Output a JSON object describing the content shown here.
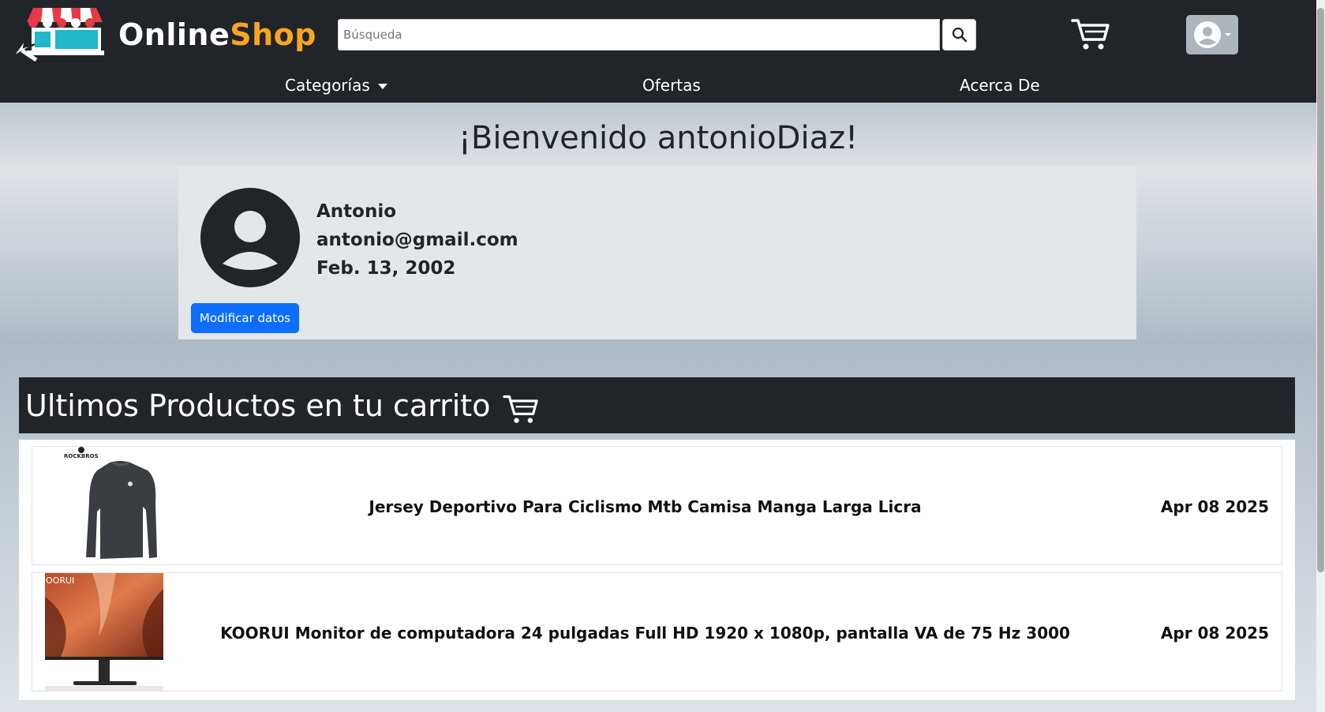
{
  "brand": {
    "name_part1": "Online",
    "name_part2": "Shop"
  },
  "search": {
    "placeholder": "Búsqueda"
  },
  "nav": {
    "categories": "Categorías",
    "offers": "Ofertas",
    "about": "Acerca De"
  },
  "welcome": "¡Bienvenido antonioDiaz!",
  "profile": {
    "name": "Antonio",
    "email": "antonio@gmail.com",
    "birthdate": "Feb. 13, 2002",
    "modify_label": "Modificar datos"
  },
  "cart": {
    "title": "Ultimos Productos en tu carrito",
    "items": [
      {
        "name": "Jersey Deportivo Para Ciclismo Mtb Camisa Manga Larga Licra",
        "date": "Apr 08 2025",
        "brand_text": "ROCKBROS"
      },
      {
        "name": "KOORUI Monitor de computadora 24 pulgadas Full HD 1920 x 1080p, pantalla VA de 75 Hz 3000",
        "date": "Apr 08 2025",
        "brand_text": "OORUI"
      }
    ]
  },
  "colors": {
    "navbar": "#212529",
    "primary_button": "#0d6efd",
    "logo_accent": "#f5a623"
  }
}
